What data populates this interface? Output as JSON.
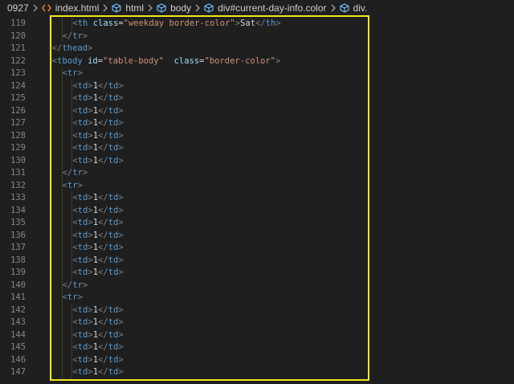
{
  "breadcrumb": {
    "items": [
      {
        "label": "0927",
        "icon": "none"
      },
      {
        "label": "index.html",
        "icon": "html-file-icon"
      },
      {
        "label": "html",
        "icon": "element-cube-icon"
      },
      {
        "label": "body",
        "icon": "element-cube-icon"
      },
      {
        "label": "div#current-day-info.color",
        "icon": "element-cube-icon"
      },
      {
        "label": "div.",
        "icon": "element-cube-icon"
      }
    ]
  },
  "colors": {
    "background": "#1f1f1f",
    "tag": "#569cd6",
    "attribute": "#9cdcfe",
    "string": "#ce9178",
    "text": "#d4d4d4",
    "line_number": "#858585",
    "highlight_border": "#f0e61c"
  },
  "editor": {
    "lines": [
      {
        "num": "119",
        "indent": 4,
        "tokens": [
          [
            "b",
            "<"
          ],
          [
            "t",
            "th"
          ],
          [
            "s",
            " "
          ],
          [
            "a",
            "class"
          ],
          [
            "e",
            "="
          ],
          [
            "q",
            "\"weekday border-color\""
          ],
          [
            "b",
            ">"
          ],
          [
            "x",
            "Sat"
          ],
          [
            "b",
            "</"
          ],
          [
            "t",
            "th"
          ],
          [
            "b",
            ">"
          ]
        ]
      },
      {
        "num": "120",
        "indent": 3,
        "tokens": [
          [
            "b",
            "</"
          ],
          [
            "t",
            "tr"
          ],
          [
            "b",
            ">"
          ]
        ]
      },
      {
        "num": "121",
        "indent": 2,
        "tokens": [
          [
            "b",
            "</"
          ],
          [
            "t",
            "thead"
          ],
          [
            "b",
            ">"
          ]
        ]
      },
      {
        "num": "122",
        "indent": 2,
        "tokens": [
          [
            "b",
            "<"
          ],
          [
            "t",
            "tbody"
          ],
          [
            "s",
            " "
          ],
          [
            "a",
            "id"
          ],
          [
            "e",
            "="
          ],
          [
            "q",
            "\"table-body\""
          ],
          [
            "s",
            "  "
          ],
          [
            "a",
            "class"
          ],
          [
            "e",
            "="
          ],
          [
            "q",
            "\"border-color\""
          ],
          [
            "b",
            ">"
          ]
        ]
      },
      {
        "num": "123",
        "indent": 3,
        "tokens": [
          [
            "b",
            "<"
          ],
          [
            "t",
            "tr"
          ],
          [
            "b",
            ">"
          ]
        ]
      },
      {
        "num": "124",
        "indent": 4,
        "tokens": [
          [
            "b",
            "<"
          ],
          [
            "t",
            "td"
          ],
          [
            "b",
            ">"
          ],
          [
            "x",
            "1"
          ],
          [
            "b",
            "</"
          ],
          [
            "t",
            "td"
          ],
          [
            "b",
            ">"
          ]
        ]
      },
      {
        "num": "125",
        "indent": 4,
        "tokens": [
          [
            "b",
            "<"
          ],
          [
            "t",
            "td"
          ],
          [
            "b",
            ">"
          ],
          [
            "x",
            "1"
          ],
          [
            "b",
            "</"
          ],
          [
            "t",
            "td"
          ],
          [
            "b",
            ">"
          ]
        ]
      },
      {
        "num": "126",
        "indent": 4,
        "tokens": [
          [
            "b",
            "<"
          ],
          [
            "t",
            "td"
          ],
          [
            "b",
            ">"
          ],
          [
            "x",
            "1"
          ],
          [
            "b",
            "</"
          ],
          [
            "t",
            "td"
          ],
          [
            "b",
            ">"
          ]
        ]
      },
      {
        "num": "127",
        "indent": 4,
        "tokens": [
          [
            "b",
            "<"
          ],
          [
            "t",
            "td"
          ],
          [
            "b",
            ">"
          ],
          [
            "x",
            "1"
          ],
          [
            "b",
            "</"
          ],
          [
            "t",
            "td"
          ],
          [
            "b",
            ">"
          ]
        ]
      },
      {
        "num": "128",
        "indent": 4,
        "tokens": [
          [
            "b",
            "<"
          ],
          [
            "t",
            "td"
          ],
          [
            "b",
            ">"
          ],
          [
            "x",
            "1"
          ],
          [
            "b",
            "</"
          ],
          [
            "t",
            "td"
          ],
          [
            "b",
            ">"
          ]
        ]
      },
      {
        "num": "129",
        "indent": 4,
        "tokens": [
          [
            "b",
            "<"
          ],
          [
            "t",
            "td"
          ],
          [
            "b",
            ">"
          ],
          [
            "x",
            "1"
          ],
          [
            "b",
            "</"
          ],
          [
            "t",
            "td"
          ],
          [
            "b",
            ">"
          ]
        ]
      },
      {
        "num": "130",
        "indent": 4,
        "tokens": [
          [
            "b",
            "<"
          ],
          [
            "t",
            "td"
          ],
          [
            "b",
            ">"
          ],
          [
            "x",
            "1"
          ],
          [
            "b",
            "</"
          ],
          [
            "t",
            "td"
          ],
          [
            "b",
            ">"
          ]
        ]
      },
      {
        "num": "131",
        "indent": 3,
        "tokens": [
          [
            "b",
            "</"
          ],
          [
            "t",
            "tr"
          ],
          [
            "b",
            ">"
          ]
        ]
      },
      {
        "num": "132",
        "indent": 3,
        "tokens": [
          [
            "b",
            "<"
          ],
          [
            "t",
            "tr"
          ],
          [
            "b",
            ">"
          ]
        ]
      },
      {
        "num": "133",
        "indent": 4,
        "tokens": [
          [
            "b",
            "<"
          ],
          [
            "t",
            "td"
          ],
          [
            "b",
            ">"
          ],
          [
            "x",
            "1"
          ],
          [
            "b",
            "</"
          ],
          [
            "t",
            "td"
          ],
          [
            "b",
            ">"
          ]
        ]
      },
      {
        "num": "134",
        "indent": 4,
        "tokens": [
          [
            "b",
            "<"
          ],
          [
            "t",
            "td"
          ],
          [
            "b",
            ">"
          ],
          [
            "x",
            "1"
          ],
          [
            "b",
            "</"
          ],
          [
            "t",
            "td"
          ],
          [
            "b",
            ">"
          ]
        ]
      },
      {
        "num": "135",
        "indent": 4,
        "tokens": [
          [
            "b",
            "<"
          ],
          [
            "t",
            "td"
          ],
          [
            "b",
            ">"
          ],
          [
            "x",
            "1"
          ],
          [
            "b",
            "</"
          ],
          [
            "t",
            "td"
          ],
          [
            "b",
            ">"
          ]
        ]
      },
      {
        "num": "136",
        "indent": 4,
        "tokens": [
          [
            "b",
            "<"
          ],
          [
            "t",
            "td"
          ],
          [
            "b",
            ">"
          ],
          [
            "x",
            "1"
          ],
          [
            "b",
            "</"
          ],
          [
            "t",
            "td"
          ],
          [
            "b",
            ">"
          ]
        ]
      },
      {
        "num": "137",
        "indent": 4,
        "tokens": [
          [
            "b",
            "<"
          ],
          [
            "t",
            "td"
          ],
          [
            "b",
            ">"
          ],
          [
            "x",
            "1"
          ],
          [
            "b",
            "</"
          ],
          [
            "t",
            "td"
          ],
          [
            "b",
            ">"
          ]
        ]
      },
      {
        "num": "138",
        "indent": 4,
        "tokens": [
          [
            "b",
            "<"
          ],
          [
            "t",
            "td"
          ],
          [
            "b",
            ">"
          ],
          [
            "x",
            "1"
          ],
          [
            "b",
            "</"
          ],
          [
            "t",
            "td"
          ],
          [
            "b",
            ">"
          ]
        ]
      },
      {
        "num": "139",
        "indent": 4,
        "tokens": [
          [
            "b",
            "<"
          ],
          [
            "t",
            "td"
          ],
          [
            "b",
            ">"
          ],
          [
            "x",
            "1"
          ],
          [
            "b",
            "</"
          ],
          [
            "t",
            "td"
          ],
          [
            "b",
            ">"
          ]
        ]
      },
      {
        "num": "140",
        "indent": 3,
        "tokens": [
          [
            "b",
            "</"
          ],
          [
            "t",
            "tr"
          ],
          [
            "b",
            ">"
          ]
        ]
      },
      {
        "num": "141",
        "indent": 3,
        "tokens": [
          [
            "b",
            "<"
          ],
          [
            "t",
            "tr"
          ],
          [
            "b",
            ">"
          ]
        ]
      },
      {
        "num": "142",
        "indent": 4,
        "tokens": [
          [
            "b",
            "<"
          ],
          [
            "t",
            "td"
          ],
          [
            "b",
            ">"
          ],
          [
            "x",
            "1"
          ],
          [
            "b",
            "</"
          ],
          [
            "t",
            "td"
          ],
          [
            "b",
            ">"
          ]
        ]
      },
      {
        "num": "143",
        "indent": 4,
        "tokens": [
          [
            "b",
            "<"
          ],
          [
            "t",
            "td"
          ],
          [
            "b",
            ">"
          ],
          [
            "x",
            "1"
          ],
          [
            "b",
            "</"
          ],
          [
            "t",
            "td"
          ],
          [
            "b",
            ">"
          ]
        ]
      },
      {
        "num": "144",
        "indent": 4,
        "tokens": [
          [
            "b",
            "<"
          ],
          [
            "t",
            "td"
          ],
          [
            "b",
            ">"
          ],
          [
            "x",
            "1"
          ],
          [
            "b",
            "</"
          ],
          [
            "t",
            "td"
          ],
          [
            "b",
            ">"
          ]
        ]
      },
      {
        "num": "145",
        "indent": 4,
        "tokens": [
          [
            "b",
            "<"
          ],
          [
            "t",
            "td"
          ],
          [
            "b",
            ">"
          ],
          [
            "x",
            "1"
          ],
          [
            "b",
            "</"
          ],
          [
            "t",
            "td"
          ],
          [
            "b",
            ">"
          ]
        ]
      },
      {
        "num": "146",
        "indent": 4,
        "tokens": [
          [
            "b",
            "<"
          ],
          [
            "t",
            "td"
          ],
          [
            "b",
            ">"
          ],
          [
            "x",
            "1"
          ],
          [
            "b",
            "</"
          ],
          [
            "t",
            "td"
          ],
          [
            "b",
            ">"
          ]
        ]
      },
      {
        "num": "147",
        "indent": 4,
        "tokens": [
          [
            "b",
            "<"
          ],
          [
            "t",
            "td"
          ],
          [
            "b",
            ">"
          ],
          [
            "x",
            "1"
          ],
          [
            "b",
            "</"
          ],
          [
            "t",
            "td"
          ],
          [
            "b",
            ">"
          ]
        ]
      }
    ]
  }
}
